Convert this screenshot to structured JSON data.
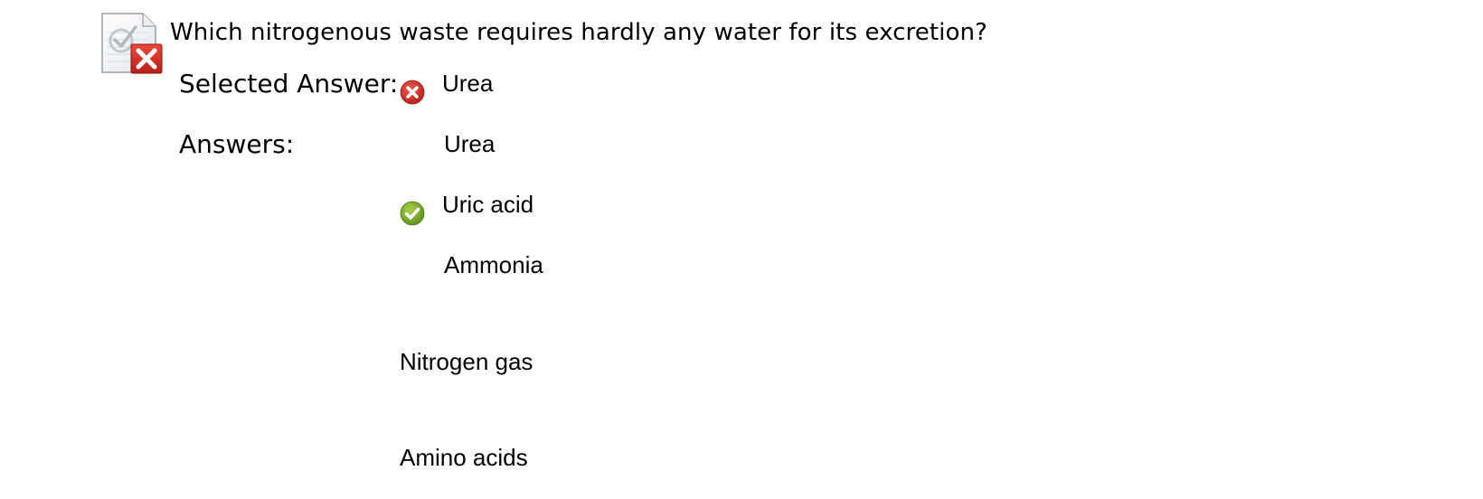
{
  "question": {
    "text": "Which nitrogenous waste requires hardly any water for its excretion?",
    "status_icon": "incorrect-question-icon"
  },
  "selected_answer": {
    "label": "Selected Answer:",
    "value": "Urea",
    "icon": "incorrect-icon"
  },
  "answers": {
    "label": "Answers:",
    "items": [
      {
        "text": "Urea",
        "icon": ""
      },
      {
        "text": "Uric acid",
        "icon": "correct-icon"
      },
      {
        "text": "Ammonia",
        "icon": ""
      },
      {
        "text": "Nitrogen gas",
        "icon": ""
      },
      {
        "text": "Amino acids",
        "icon": ""
      }
    ]
  },
  "colors": {
    "incorrect": "#d0302a",
    "correct": "#7aab2a"
  }
}
